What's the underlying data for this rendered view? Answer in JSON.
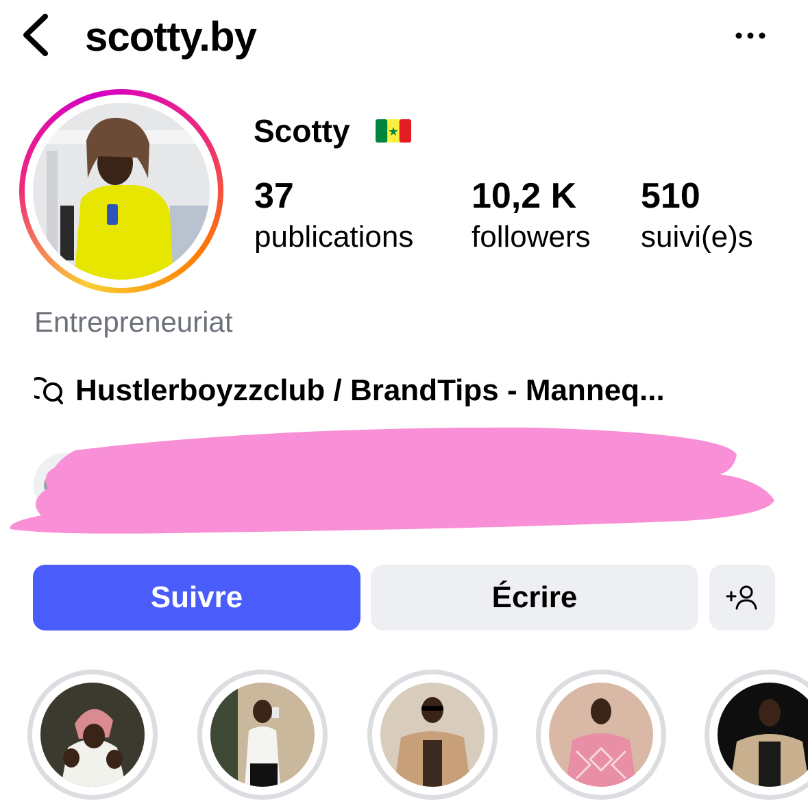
{
  "header": {
    "back_icon": "chevron-left-icon",
    "username": "scotty.by",
    "more_icon": "ellipsis-icon"
  },
  "profile": {
    "display_name": "Scotty",
    "flag_icon": "senegal-flag-icon",
    "stats": [
      {
        "value": "37",
        "label": "publications"
      },
      {
        "value": "10,2 K",
        "label": "followers"
      },
      {
        "value": "510",
        "label": "suivi(e)s"
      }
    ],
    "category": "Entrepreneuriat",
    "threads_icon": "threads-icon",
    "threads_text": "Hustlerboyzzclub / BrandTips - Manneq..."
  },
  "actions": {
    "follow_label": "Suivre",
    "message_label": "Écrire",
    "add_user_icon": "add-user-icon"
  },
  "colors": {
    "follow_button": "#4a5dfb",
    "secondary_button": "#eeeff2",
    "category_text": "#6c717a",
    "redaction": "#f98fd6"
  }
}
